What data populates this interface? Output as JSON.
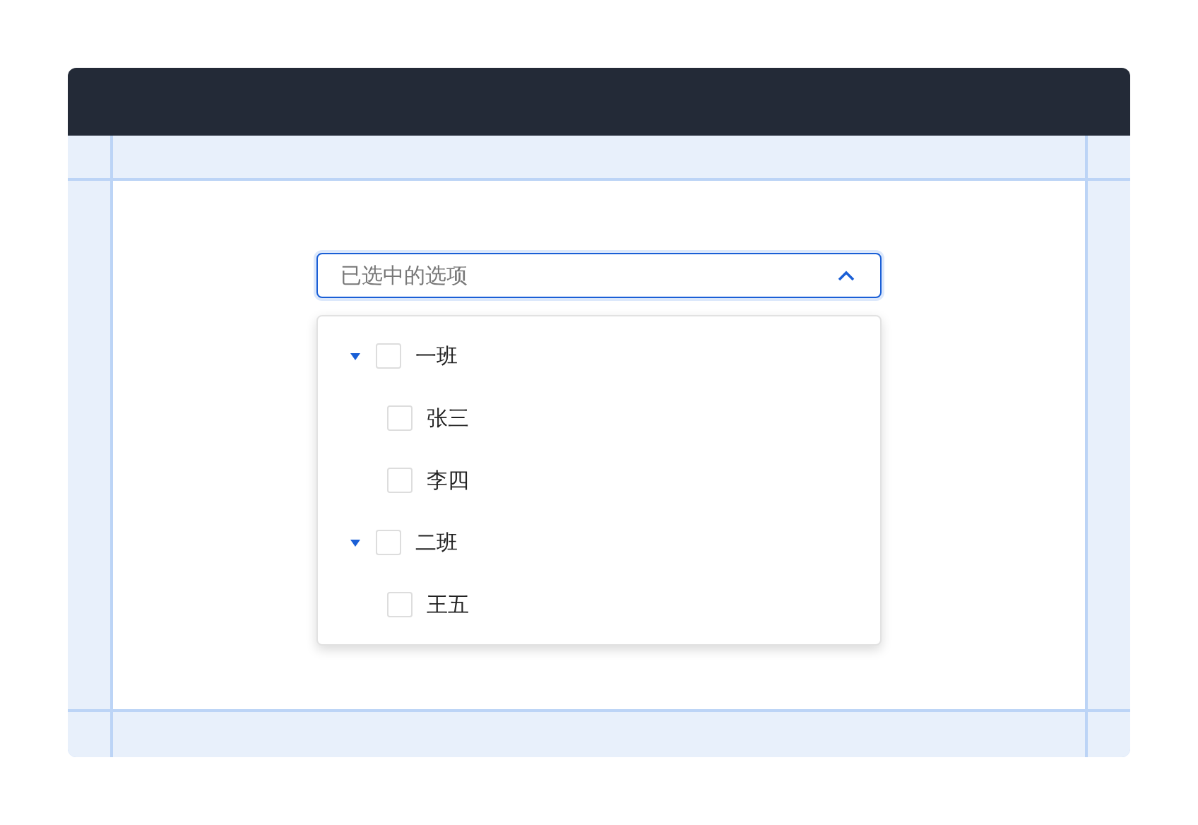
{
  "select": {
    "placeholder": "已选中的选项",
    "open": true
  },
  "tree": [
    {
      "label": "一班",
      "checked": false,
      "expanded": true,
      "children": [
        {
          "label": "张三",
          "checked": false
        },
        {
          "label": "李四",
          "checked": false
        }
      ]
    },
    {
      "label": "二班",
      "checked": false,
      "expanded": true,
      "children": [
        {
          "label": "王五",
          "checked": false
        }
      ]
    }
  ]
}
